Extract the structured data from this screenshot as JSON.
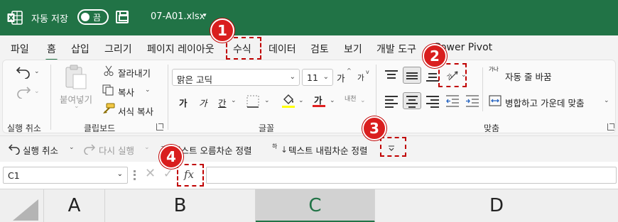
{
  "titlebar": {
    "autosave_label": "자동 저장",
    "autosave_state": "끔",
    "filename": "07-A01.xlsx",
    "filename_caret": "▾"
  },
  "tabs": [
    {
      "label": "파일"
    },
    {
      "label": "홈"
    },
    {
      "label": "삽입"
    },
    {
      "label": "그리기"
    },
    {
      "label": "페이지 레이아웃"
    },
    {
      "label": "수식"
    },
    {
      "label": "데이터"
    },
    {
      "label": "검토"
    },
    {
      "label": "보기"
    },
    {
      "label": "개발 도구"
    },
    {
      "label": "Power Pivot"
    }
  ],
  "ribbon": {
    "undo_group": {
      "label": "실행 취소"
    },
    "clipboard": {
      "paste": "붙여넣기",
      "cut": "잘라내기",
      "copy": "복사",
      "format_painter": "서식 복사",
      "label": "클립보드"
    },
    "font": {
      "font_name": "맑은 고딕",
      "font_size": "11",
      "grow": "가",
      "shrink": "가",
      "bold": "가",
      "italic": "가",
      "underline": "간",
      "font_color_glyph": "가",
      "phonetic": "내천",
      "label": "글꼴"
    },
    "alignment": {
      "wrap_text": "자동 줄 바꿈",
      "merge_center": "병합하고 가운데 맞춤",
      "orientation_glyph": "가",
      "wrap_glyph": "가나",
      "label": "맞춤"
    }
  },
  "qat": {
    "undo": "실행 취소",
    "redo": "다시 실행",
    "sort_asc": "텍스트 오름차순 정렬",
    "sort_desc": "텍스트 내림차순 정렬",
    "sort_asc_glyph": "가",
    "sort_desc_glyph": "하"
  },
  "formula_bar": {
    "namebox": "C1",
    "fx": "fx"
  },
  "columns": [
    {
      "label": "A"
    },
    {
      "label": "B"
    },
    {
      "label": "C"
    },
    {
      "label": "D"
    }
  ],
  "callouts": [
    "1",
    "2",
    "3",
    "4"
  ],
  "colors": {
    "brand_green": "#217346",
    "callout_red": "#d91e1e"
  }
}
